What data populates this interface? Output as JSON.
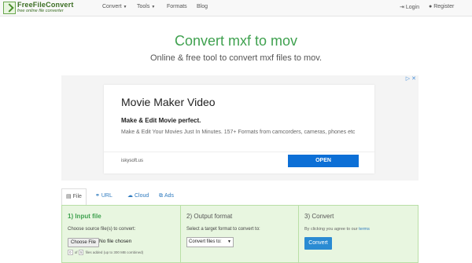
{
  "brand": {
    "name": "FreeFileConvert",
    "tagline": "free online file converter"
  },
  "nav": {
    "convert": "Convert",
    "tools": "Tools",
    "formats": "Formats",
    "blog": "Blog",
    "login": "Login",
    "register": "Register"
  },
  "hero": {
    "title": "Convert mxf to mov",
    "subtitle": "Online & free tool to convert mxf files to mov."
  },
  "ad": {
    "title": "Movie Maker Video",
    "headline": "Make & Edit Movie perfect.",
    "body": "Make & Edit Your Movies Just In Minutes. 157+ Formats from camcorders, cameras, phones etc",
    "domain": "iskysoft.us",
    "cta": "OPEN"
  },
  "tabs": [
    {
      "label": "File",
      "icon": "file-icon",
      "active": true
    },
    {
      "label": "URL",
      "icon": "link-icon",
      "active": false
    },
    {
      "label": "Cloud",
      "icon": "cloud-icon",
      "active": false
    },
    {
      "label": "Ads",
      "icon": "external-link-icon",
      "active": false
    }
  ],
  "step1": {
    "heading": "1) Input file",
    "instruction": "Choose source file(s) to convert:",
    "choose_label": "Choose File",
    "file_status": "No file chosen",
    "count_current": "0",
    "count_of": "of",
    "count_max": "5",
    "count_note": "files added (up to 300 MB combined)"
  },
  "step2": {
    "heading": "2) Output format",
    "instruction": "Select a target format to convert to:",
    "select_value": "Convert files to:"
  },
  "step3": {
    "heading": "3) Convert",
    "terms_prefix": "By clicking you agree to our",
    "terms_link": "terms",
    "button": "Convert"
  },
  "colors": {
    "accent_green": "#3fa14f",
    "panel_bg": "#e8f6e0",
    "primary_blue": "#2a8bd3",
    "ad_button": "#0c6fd6"
  }
}
